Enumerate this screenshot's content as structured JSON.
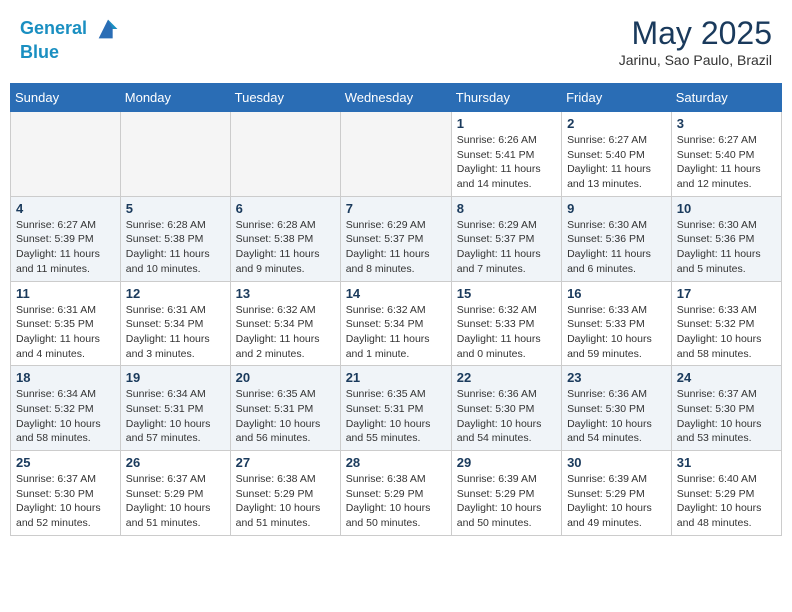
{
  "header": {
    "logo_line1": "General",
    "logo_line2": "Blue",
    "month": "May 2025",
    "location": "Jarinu, Sao Paulo, Brazil"
  },
  "weekdays": [
    "Sunday",
    "Monday",
    "Tuesday",
    "Wednesday",
    "Thursday",
    "Friday",
    "Saturday"
  ],
  "weeks": [
    [
      {
        "day": "",
        "info": "",
        "empty": true
      },
      {
        "day": "",
        "info": "",
        "empty": true
      },
      {
        "day": "",
        "info": "",
        "empty": true
      },
      {
        "day": "",
        "info": "",
        "empty": true
      },
      {
        "day": "1",
        "info": "Sunrise: 6:26 AM\nSunset: 5:41 PM\nDaylight: 11 hours\nand 14 minutes."
      },
      {
        "day": "2",
        "info": "Sunrise: 6:27 AM\nSunset: 5:40 PM\nDaylight: 11 hours\nand 13 minutes."
      },
      {
        "day": "3",
        "info": "Sunrise: 6:27 AM\nSunset: 5:40 PM\nDaylight: 11 hours\nand 12 minutes."
      }
    ],
    [
      {
        "day": "4",
        "info": "Sunrise: 6:27 AM\nSunset: 5:39 PM\nDaylight: 11 hours\nand 11 minutes."
      },
      {
        "day": "5",
        "info": "Sunrise: 6:28 AM\nSunset: 5:38 PM\nDaylight: 11 hours\nand 10 minutes."
      },
      {
        "day": "6",
        "info": "Sunrise: 6:28 AM\nSunset: 5:38 PM\nDaylight: 11 hours\nand 9 minutes."
      },
      {
        "day": "7",
        "info": "Sunrise: 6:29 AM\nSunset: 5:37 PM\nDaylight: 11 hours\nand 8 minutes."
      },
      {
        "day": "8",
        "info": "Sunrise: 6:29 AM\nSunset: 5:37 PM\nDaylight: 11 hours\nand 7 minutes."
      },
      {
        "day": "9",
        "info": "Sunrise: 6:30 AM\nSunset: 5:36 PM\nDaylight: 11 hours\nand 6 minutes."
      },
      {
        "day": "10",
        "info": "Sunrise: 6:30 AM\nSunset: 5:36 PM\nDaylight: 11 hours\nand 5 minutes."
      }
    ],
    [
      {
        "day": "11",
        "info": "Sunrise: 6:31 AM\nSunset: 5:35 PM\nDaylight: 11 hours\nand 4 minutes."
      },
      {
        "day": "12",
        "info": "Sunrise: 6:31 AM\nSunset: 5:34 PM\nDaylight: 11 hours\nand 3 minutes."
      },
      {
        "day": "13",
        "info": "Sunrise: 6:32 AM\nSunset: 5:34 PM\nDaylight: 11 hours\nand 2 minutes."
      },
      {
        "day": "14",
        "info": "Sunrise: 6:32 AM\nSunset: 5:34 PM\nDaylight: 11 hours\nand 1 minute."
      },
      {
        "day": "15",
        "info": "Sunrise: 6:32 AM\nSunset: 5:33 PM\nDaylight: 11 hours\nand 0 minutes."
      },
      {
        "day": "16",
        "info": "Sunrise: 6:33 AM\nSunset: 5:33 PM\nDaylight: 10 hours\nand 59 minutes."
      },
      {
        "day": "17",
        "info": "Sunrise: 6:33 AM\nSunset: 5:32 PM\nDaylight: 10 hours\nand 58 minutes."
      }
    ],
    [
      {
        "day": "18",
        "info": "Sunrise: 6:34 AM\nSunset: 5:32 PM\nDaylight: 10 hours\nand 58 minutes."
      },
      {
        "day": "19",
        "info": "Sunrise: 6:34 AM\nSunset: 5:31 PM\nDaylight: 10 hours\nand 57 minutes."
      },
      {
        "day": "20",
        "info": "Sunrise: 6:35 AM\nSunset: 5:31 PM\nDaylight: 10 hours\nand 56 minutes."
      },
      {
        "day": "21",
        "info": "Sunrise: 6:35 AM\nSunset: 5:31 PM\nDaylight: 10 hours\nand 55 minutes."
      },
      {
        "day": "22",
        "info": "Sunrise: 6:36 AM\nSunset: 5:30 PM\nDaylight: 10 hours\nand 54 minutes."
      },
      {
        "day": "23",
        "info": "Sunrise: 6:36 AM\nSunset: 5:30 PM\nDaylight: 10 hours\nand 54 minutes."
      },
      {
        "day": "24",
        "info": "Sunrise: 6:37 AM\nSunset: 5:30 PM\nDaylight: 10 hours\nand 53 minutes."
      }
    ],
    [
      {
        "day": "25",
        "info": "Sunrise: 6:37 AM\nSunset: 5:30 PM\nDaylight: 10 hours\nand 52 minutes."
      },
      {
        "day": "26",
        "info": "Sunrise: 6:37 AM\nSunset: 5:29 PM\nDaylight: 10 hours\nand 51 minutes."
      },
      {
        "day": "27",
        "info": "Sunrise: 6:38 AM\nSunset: 5:29 PM\nDaylight: 10 hours\nand 51 minutes."
      },
      {
        "day": "28",
        "info": "Sunrise: 6:38 AM\nSunset: 5:29 PM\nDaylight: 10 hours\nand 50 minutes."
      },
      {
        "day": "29",
        "info": "Sunrise: 6:39 AM\nSunset: 5:29 PM\nDaylight: 10 hours\nand 50 minutes."
      },
      {
        "day": "30",
        "info": "Sunrise: 6:39 AM\nSunset: 5:29 PM\nDaylight: 10 hours\nand 49 minutes."
      },
      {
        "day": "31",
        "info": "Sunrise: 6:40 AM\nSunset: 5:29 PM\nDaylight: 10 hours\nand 48 minutes."
      }
    ]
  ]
}
